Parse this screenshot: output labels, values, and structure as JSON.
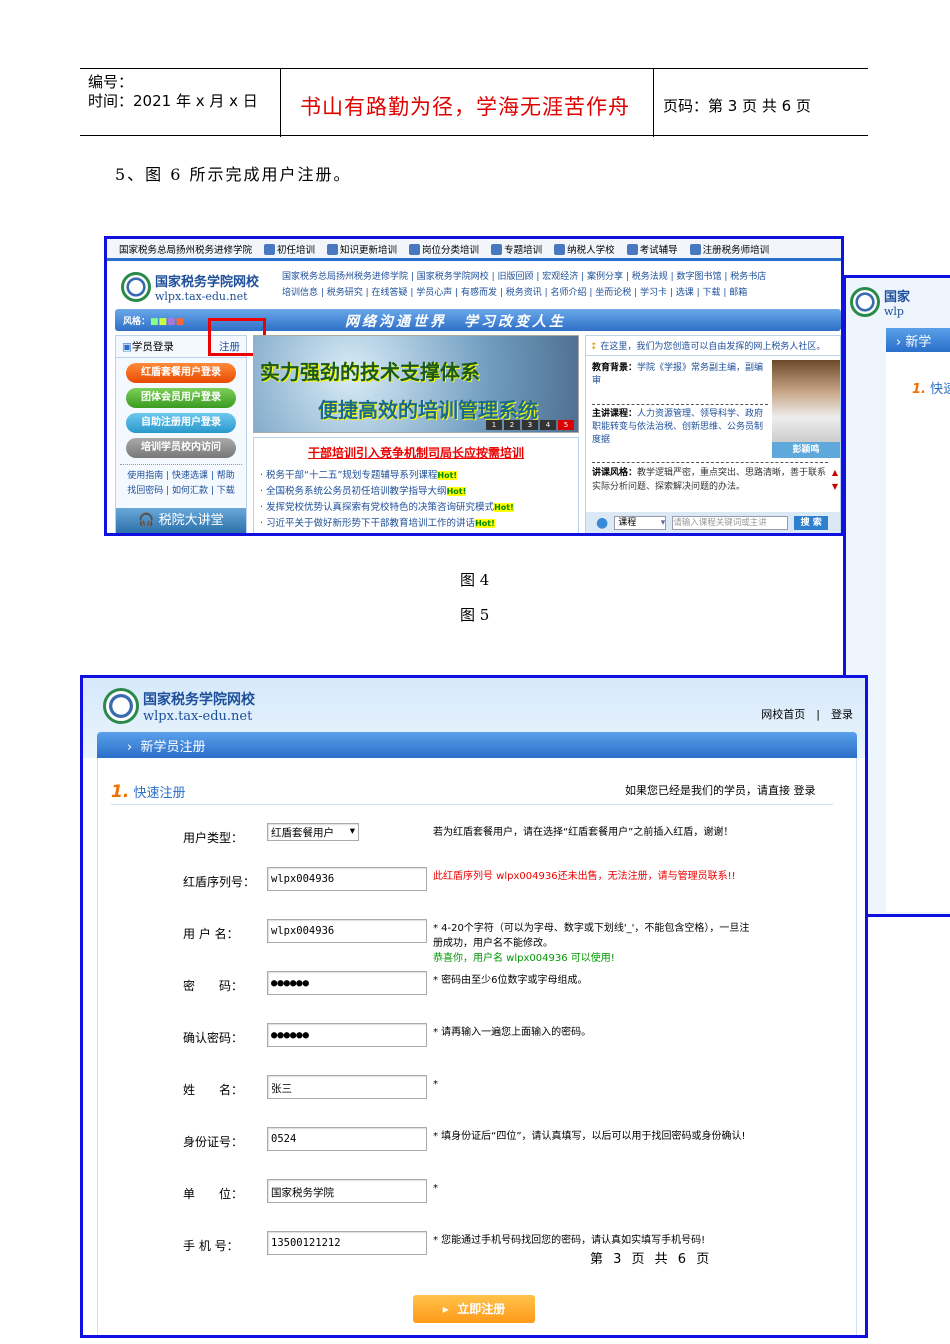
{
  "header": {
    "number_label": "编号：",
    "time_label": "时间：2021 年 x 月 x 日",
    "motto": "书山有路勤为径，学海无涯苦作舟",
    "page_info": "页码：第 3 页  共 6 页"
  },
  "paragraph": "5、图 6 所示完成用户注册。",
  "captions": {
    "fig4": "图 4",
    "fig5": "图 5"
  },
  "fig4": {
    "topnav": [
      "国家税务总局扬州税务进修学院",
      "初任培训",
      "知识更新培训",
      "岗位分类培训",
      "专题培训",
      "纳税人学校",
      "考试辅导",
      "注册税务师培训"
    ],
    "logo_cn": "国家税务学院网校",
    "logo_url": "wlpx.tax-edu.net",
    "links_row1": "国家税务总局扬州税务进修学院 | 国家税务学院网校 | 旧版回顾 | 宏观经济 | 案例分享 | 税务法规 | 数字图书馆 | 税务书店",
    "links_row2": "培训信息 | 税务研究 | 在线答疑 | 学员心声 | 有感而发 | 税务资讯 | 名师介绍 | 坐而论税 | 学习卡 | 选课 | 下载 | 邮箱",
    "style_label": "风格：",
    "slogan": "网络沟通世界　学习改变人生",
    "login_title": "学员登录",
    "register_link": "注册",
    "login_buttons": [
      "红盾套餐用户登录",
      "团体会员用户登录",
      "自助注册用户登录",
      "培训学员校内访问"
    ],
    "help_row1": "使用指南 | 快速选课 | 帮助",
    "help_row2": "找回密码 | 如何汇款 | 下载",
    "lecture": "税院大讲堂",
    "slide_line1": "实力强劲的技术支撑体系",
    "slide_line2": "便捷高效的培训管理系统",
    "pages": [
      "1",
      "2",
      "3",
      "4",
      "5"
    ],
    "news_title": "干部培训引入竞争机制司局长应按需培训",
    "news": [
      "税务干部“十二五”规划专题辅导系列课程",
      "全国税务系统公务员初任培训教学指导大纲",
      "发挥党校优势认真探索有党校特色的决策咨询研究模式",
      "习近平关于做好新形势下干部教育培训工作的讲话"
    ],
    "hot": "Hot!",
    "community": "在这里，我们为您创造可以自由发挥的网上税务人社区。",
    "edu_label": "教育背景：",
    "edu_value": "学院《学报》常务副主编，副编审",
    "course_label": "主讲课程：",
    "course_value": "人力资源管理、领导科学、政府职能转变与依法治税、创新思维、公务员制度据",
    "teacher": "彭颖鸣",
    "style_label2": "讲课风格：",
    "style_value": "教学逻辑严密，重点突出、思路清晰，善于联系实际分析问题、探索解决问题的办法。",
    "search_select": "课程",
    "search_placeholder": "请输入课程关键词或主讲",
    "search_button": "搜 索"
  },
  "fig5": {
    "logo_cn": "国家",
    "logo_url": "wlp",
    "bar": "新学",
    "quick": "快速"
  },
  "fig6": {
    "logo_cn": "国家税务学院网校",
    "logo_url": "wlpx.tax-edu.net",
    "nav_home": "网校首页",
    "nav_sep": "|",
    "nav_login": "登录",
    "bar_title": "新学员注册",
    "step_num": "1.",
    "step_title": "快速注册",
    "already": "如果您已经是我们的学员，请直接 登录",
    "fields": [
      {
        "label": "用户类型：",
        "value": "红盾套餐用户",
        "hint": "若为红盾套餐用户，请在选择“红盾套餐用户”之前插入红盾，谢谢！"
      },
      {
        "label": "红盾序列号：",
        "value": "wlpx004936",
        "hint": "此红盾序列号 wlpx004936还未出售，无法注册，请与管理员联系!!"
      },
      {
        "label": "用 户 名：",
        "value": "wlpx004936",
        "hint": "* 4-20个字符（可以为字母、数字或下划线'_'，不能包含空格），一旦注册成功，用户名不能修改。",
        "ok": "恭喜你，用户名 wlpx004936 可以使用!"
      },
      {
        "label": "密　　码：",
        "value": "●●●●●●",
        "hint": "* 密码由至少6位数字或字母组成。"
      },
      {
        "label": "确认密码：",
        "value": "●●●●●●",
        "hint": "* 请再输入一遍您上面输入的密码。"
      },
      {
        "label": "姓　　名：",
        "value": "张三",
        "hint": "*"
      },
      {
        "label": "身份证号：",
        "value": "0524",
        "hint": "* 填身份证后“四位”，请认真填写，以后可以用于找回密码或身份确认!"
      },
      {
        "label": "单　　位：",
        "value": "国家税务学院",
        "hint": "*"
      },
      {
        "label": "手 机 号：",
        "value": "13500121212",
        "hint": "* 您能通过手机号码找回您的密码，请认真如实填写手机号码!"
      }
    ],
    "submit": "立即注册"
  },
  "footer": "第 3 页 共 6 页"
}
